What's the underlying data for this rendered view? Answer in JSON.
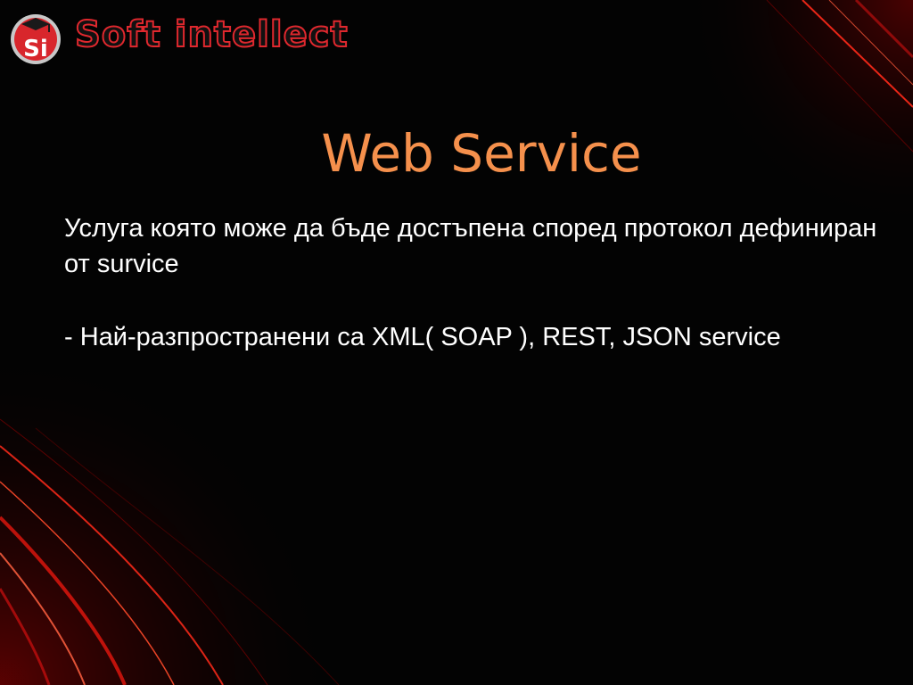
{
  "logo": {
    "badge_text": "Si",
    "wordmark": "Soft intellect"
  },
  "slide": {
    "title": "Web Service",
    "paragraph_1": "Услуга която може да бъде достъпена според протокол дефиниран от survice",
    "paragraph_2": "- Най-разпространени са XML( SOAP ), REST, JSON service"
  },
  "colors": {
    "background": "#030303",
    "title": "#f5904c",
    "body_text": "#ffffff",
    "brand_red": "#e0282e"
  }
}
